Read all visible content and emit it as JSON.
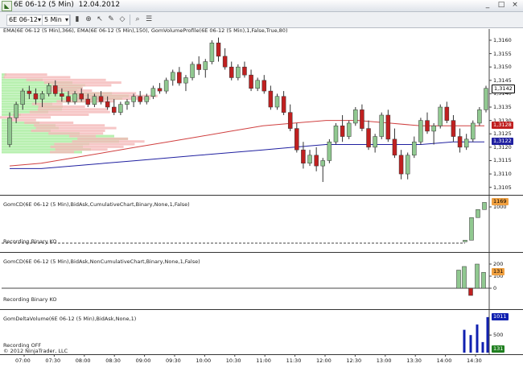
{
  "window": {
    "title": "6E 06-12 (5 Min)  12.04.2012",
    "minimize": "_",
    "maximize": "□",
    "close": "×"
  },
  "toolbar": {
    "instrument": "6E 06-12",
    "period": "5 Min",
    "dropdown_arrow": "▾"
  },
  "panels": {
    "price": {
      "label": "EMA(6E 06-12 (5 Min),366), EMA(6E 06-12 (5 Min),150), GomVolumeProfile(6E 06-12 (5 Min),1,False,True,80)",
      "axis": [
        "1,3160",
        "1,3155",
        "1,3150",
        "1,3145",
        "1,3140",
        "1,3135",
        "1,3130",
        "1,3125",
        "1,3120",
        "1,3115",
        "1,3110",
        "1,3105"
      ],
      "last_price": "1,3142",
      "ema_fast_value": "1,3128",
      "ema_slow_value": "1,3122"
    },
    "cd_cumulative": {
      "label": "GomCD(6E 06-12 (5 Min),BidAsk,CumulativeChart,Binary,None,1,False)",
      "status": "Recording Binary KO",
      "axis": [
        "1000"
      ],
      "value_flag": "1169"
    },
    "cd_noncumulative": {
      "label": "GomCD(6E 06-12 (5 Min),BidAsk,NonCumulativeChart,Binary,None,1,False)",
      "status": "Recording Binary KO",
      "axis": [
        "200",
        "100",
        "0"
      ],
      "value_flag": "131"
    },
    "delta_volume": {
      "label": "GomDeltaVolume(6E 06-12 (5 Min),BidAsk,None,1)",
      "status": "Recording OFF",
      "axis": [
        "500"
      ],
      "value_flag_top": "1011",
      "value_flag_bottom": "131"
    }
  },
  "copyright": "© 2012 NinjaTrader, LLC",
  "x_axis": [
    "07:00",
    "07:30",
    "08:00",
    "08:30",
    "09:00",
    "09:30",
    "10:00",
    "10:30",
    "11:00",
    "11:30",
    "12:00",
    "12:30",
    "13:00",
    "13:30",
    "14:00",
    "14:30"
  ],
  "colors": {
    "up_candle": "#90c890",
    "down_candle": "#c02020",
    "ema_fast": "#d04040",
    "ema_slow": "#2020a0",
    "volume_profile_up": "#b8f0b0",
    "volume_profile_down": "#f4b8b8",
    "cd_line": "#303030",
    "delta_bar": "#1020b0",
    "flag_last": "#ffffff",
    "flag_orange": "#f0a040"
  },
  "chart_data": {
    "type": "candlestick",
    "x_ticks": [
      "07:00",
      "07:30",
      "08:00",
      "08:30",
      "09:00",
      "09:30",
      "10:00",
      "10:30",
      "11:00",
      "11:30",
      "12:00",
      "12:30",
      "13:00",
      "13:30",
      "14:00",
      "14:30"
    ],
    "y_range": [
      1.3104,
      1.3163
    ],
    "ohlc": [
      [
        1.3121,
        1.3133,
        1.312,
        1.3131
      ],
      [
        1.3131,
        1.3137,
        1.3129,
        1.3136
      ],
      [
        1.3136,
        1.3142,
        1.3134,
        1.3141
      ],
      [
        1.3141,
        1.3143,
        1.3138,
        1.314
      ],
      [
        1.314,
        1.3142,
        1.3136,
        1.3138
      ],
      [
        1.3138,
        1.3141,
        1.3135,
        1.314
      ],
      [
        1.314,
        1.3144,
        1.3139,
        1.3143
      ],
      [
        1.3143,
        1.3145,
        1.3139,
        1.314
      ],
      [
        1.314,
        1.3142,
        1.3137,
        1.3139
      ],
      [
        1.3139,
        1.3141,
        1.3136,
        1.3137
      ],
      [
        1.3137,
        1.3141,
        1.3136,
        1.314
      ],
      [
        1.314,
        1.3142,
        1.3137,
        1.3138
      ],
      [
        1.3138,
        1.314,
        1.3135,
        1.3136
      ],
      [
        1.3136,
        1.314,
        1.3135,
        1.3139
      ],
      [
        1.3139,
        1.3141,
        1.3136,
        1.3137
      ],
      [
        1.3137,
        1.3139,
        1.3134,
        1.3135
      ],
      [
        1.3135,
        1.3138,
        1.3132,
        1.3133
      ],
      [
        1.3133,
        1.3137,
        1.3132,
        1.3136
      ],
      [
        1.3136,
        1.3138,
        1.3134,
        1.3137
      ],
      [
        1.3137,
        1.314,
        1.3135,
        1.3139
      ],
      [
        1.3139,
        1.3141,
        1.3136,
        1.3137
      ],
      [
        1.3137,
        1.314,
        1.3136,
        1.3139
      ],
      [
        1.3139,
        1.3143,
        1.3138,
        1.3142
      ],
      [
        1.3142,
        1.3144,
        1.314,
        1.3141
      ],
      [
        1.3141,
        1.3146,
        1.314,
        1.3145
      ],
      [
        1.3145,
        1.3149,
        1.3143,
        1.3148
      ],
      [
        1.3148,
        1.315,
        1.3143,
        1.3144
      ],
      [
        1.3144,
        1.3147,
        1.3141,
        1.3146
      ],
      [
        1.3146,
        1.3152,
        1.3145,
        1.3151
      ],
      [
        1.3151,
        1.3154,
        1.3147,
        1.3149
      ],
      [
        1.3149,
        1.3153,
        1.3146,
        1.3152
      ],
      [
        1.3152,
        1.316,
        1.3151,
        1.3159
      ],
      [
        1.3159,
        1.3161,
        1.3152,
        1.3154
      ],
      [
        1.3154,
        1.3157,
        1.3149,
        1.315
      ],
      [
        1.315,
        1.3152,
        1.3145,
        1.3146
      ],
      [
        1.3146,
        1.3151,
        1.3145,
        1.315
      ],
      [
        1.315,
        1.3152,
        1.3146,
        1.3147
      ],
      [
        1.3147,
        1.3149,
        1.3141,
        1.3142
      ],
      [
        1.3142,
        1.3146,
        1.3141,
        1.3145
      ],
      [
        1.3145,
        1.3147,
        1.314,
        1.3141
      ],
      [
        1.3141,
        1.3143,
        1.3134,
        1.3135
      ],
      [
        1.3135,
        1.314,
        1.3134,
        1.3139
      ],
      [
        1.3139,
        1.3141,
        1.3132,
        1.3133
      ],
      [
        1.3133,
        1.3136,
        1.3126,
        1.3127
      ],
      [
        1.3127,
        1.3129,
        1.3118,
        1.3119
      ],
      [
        1.3119,
        1.3122,
        1.3112,
        1.3114
      ],
      [
        1.3114,
        1.3119,
        1.3113,
        1.3117
      ],
      [
        1.3117,
        1.312,
        1.3111,
        1.3113
      ],
      [
        1.3113,
        1.3116,
        1.3107,
        1.3115
      ],
      [
        1.3115,
        1.3123,
        1.3114,
        1.3122
      ],
      [
        1.3122,
        1.3129,
        1.3121,
        1.3128
      ],
      [
        1.3128,
        1.3132,
        1.3122,
        1.3124
      ],
      [
        1.3124,
        1.313,
        1.3123,
        1.3129
      ],
      [
        1.3129,
        1.3135,
        1.3128,
        1.3134
      ],
      [
        1.3134,
        1.3136,
        1.3126,
        1.3127
      ],
      [
        1.3127,
        1.313,
        1.3119,
        1.312
      ],
      [
        1.312,
        1.3125,
        1.3118,
        1.3124
      ],
      [
        1.3124,
        1.3133,
        1.3123,
        1.3132
      ],
      [
        1.3132,
        1.3134,
        1.3122,
        1.3123
      ],
      [
        1.3123,
        1.3127,
        1.3116,
        1.3117
      ],
      [
        1.3117,
        1.3119,
        1.3108,
        1.311
      ],
      [
        1.311,
        1.3118,
        1.3108,
        1.3117
      ],
      [
        1.3117,
        1.3124,
        1.3116,
        1.3122
      ],
      [
        1.3122,
        1.3131,
        1.3121,
        1.313
      ],
      [
        1.313,
        1.3133,
        1.3125,
        1.3126
      ],
      [
        1.3126,
        1.3129,
        1.3121,
        1.3128
      ],
      [
        1.3128,
        1.3136,
        1.3127,
        1.3135
      ],
      [
        1.3135,
        1.3137,
        1.3129,
        1.313
      ],
      [
        1.313,
        1.3132,
        1.3122,
        1.3124
      ],
      [
        1.3124,
        1.3127,
        1.3118,
        1.312
      ],
      [
        1.312,
        1.3125,
        1.3119,
        1.3123
      ],
      [
        1.3123,
        1.313,
        1.3122,
        1.3129
      ],
      [
        1.3129,
        1.3135,
        1.3128,
        1.3134
      ],
      [
        1.3134,
        1.3143,
        1.3133,
        1.3142
      ]
    ],
    "ema_fast": [
      1.3113,
      1.3114,
      1.3116,
      1.3118,
      1.312,
      1.3122,
      1.3124,
      1.3126,
      1.3128,
      1.3129,
      1.313,
      1.313,
      1.3129,
      1.3128,
      1.3128,
      1.3128
    ],
    "ema_slow": [
      1.3112,
      1.3112,
      1.3113,
      1.3114,
      1.3115,
      1.3116,
      1.3117,
      1.3118,
      1.3119,
      1.312,
      1.3121,
      1.3121,
      1.3121,
      1.3121,
      1.3122,
      1.3122
    ],
    "cd_cumulative": [
      -300,
      -300,
      -300,
      -300,
      -300,
      -300,
      -300,
      -300,
      -300,
      -300,
      -300,
      -300,
      -300,
      -300,
      -250,
      600,
      900,
      1169
    ],
    "cd_noncumulative": [
      0,
      0,
      0,
      0,
      0,
      150,
      180,
      -60,
      200,
      131
    ],
    "delta_volume": [
      650,
      500,
      800,
      300,
      1011,
      131
    ]
  }
}
